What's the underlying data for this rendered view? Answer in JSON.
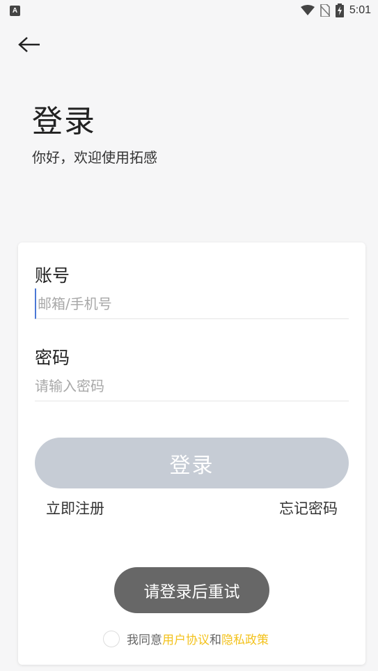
{
  "status_bar": {
    "app_badge": "A",
    "time": "5:01"
  },
  "header": {
    "title": "登录",
    "subtitle": "你好，欢迎使用拓感"
  },
  "form": {
    "account_label": "账号",
    "account_placeholder": "邮箱/手机号",
    "password_label": "密码",
    "password_placeholder": "请输入密码",
    "login_button": "登录",
    "register_link": "立即注册",
    "forgot_link": "忘记密码"
  },
  "toast": "请登录后重试",
  "agreement": {
    "prefix": "我同意",
    "user_agreement": "用户协议",
    "and": "和",
    "privacy_policy": "隐私政策"
  },
  "colors": {
    "accent_link": "#f3c21c",
    "login_button_disabled": "#c6ccd5",
    "toast_bg": "#676767"
  }
}
